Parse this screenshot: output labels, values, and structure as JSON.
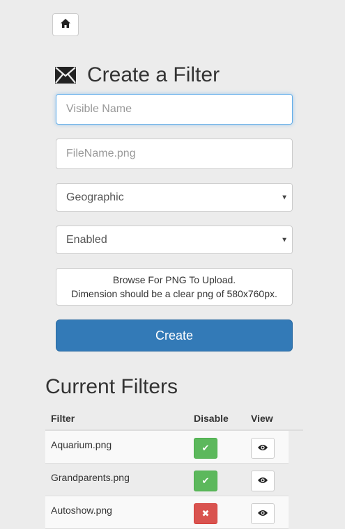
{
  "header": {
    "home_icon": "home-icon"
  },
  "form": {
    "title": "Create a Filter",
    "title_icon": "envelope-icon",
    "visible_name": {
      "placeholder": "Visible Name",
      "value": ""
    },
    "file_name": {
      "placeholder": "FileName.png",
      "value": ""
    },
    "category_select": {
      "selected": "Geographic"
    },
    "status_select": {
      "selected": "Enabled"
    },
    "upload": {
      "line1": "Browse For PNG To Upload.",
      "line2": "Dimension should be a clear png of 580x760px."
    },
    "create_label": "Create"
  },
  "filters_section": {
    "title": "Current Filters",
    "columns": {
      "filter": "Filter",
      "disable": "Disable",
      "view": "View"
    },
    "rows": [
      {
        "name": "Aquarium.png",
        "enabled": true
      },
      {
        "name": "Grandparents.png",
        "enabled": true
      },
      {
        "name": "Autoshow.png",
        "enabled": false
      }
    ]
  },
  "colors": {
    "primary": "#337ab7",
    "success": "#5cb85c",
    "danger": "#d9534f",
    "background": "#ececec"
  }
}
